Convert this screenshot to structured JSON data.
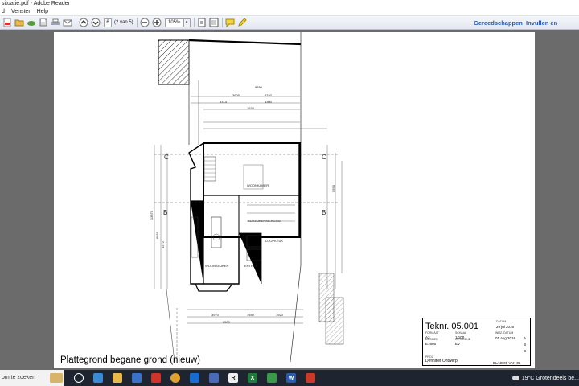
{
  "window": {
    "title": "situatie.pdf - Adobe Reader"
  },
  "menu": [
    "d",
    "Venster",
    "Help"
  ],
  "toolbar": {
    "page_current": "6",
    "page_count": "(2 van 5)",
    "zoom": "105%",
    "tools_link": "Gereedschappen",
    "fill_sign_link": "Invullen en onderteke"
  },
  "drawing": {
    "plan_title": "Plattegrond begane grond (nieuw)",
    "rooms": {
      "woonkamer": "WOONKAMER",
      "bijkeuken": "BIJKEUKEN/BERGING",
      "woonkeuken": "WOONKEUKEN",
      "entree": "ENTREE",
      "loopkeuk": "LOOPKEUK"
    },
    "axes": {
      "c": "C",
      "b": "B"
    },
    "dims": {
      "d1": "3605",
      "d2": "4340",
      "d3": "3314",
      "d4": "4300",
      "d5": "1634",
      "d6": "9880",
      "d7": "3970",
      "d8": "1940",
      "d9": "1920",
      "d10": "8500",
      "d11": "13870",
      "d12": "6850",
      "d13": "8272",
      "d14": "5590"
    },
    "titleblock": {
      "tekening_nr": "Teknr. 05.001",
      "datum": "29 jul 2016",
      "formaat": "A3",
      "schaal": "1/100",
      "dossier": "E1605",
      "getekend": "EV",
      "wijz_datum": "01 aug 2016",
      "rev_a": "A",
      "rev_b": "B",
      "rev_c": "C",
      "project_name": "Definitief Ontwerp",
      "code": "ELAO 05 VAK 05",
      "label_datum": "DATUM",
      "label_formaat": "FORMAAT",
      "label_schaal": "SCHAAL",
      "label_dossier": "DOSSIER",
      "label_getekend": "GETEKEND",
      "label_wijz": "WIJZ. DATUM",
      "label_project": "PROJ"
    }
  },
  "taskbar": {
    "search_text": "om te zoeken",
    "weather": "19°C Grotendeels be..."
  },
  "colors": {
    "accent": "#2a5aa8",
    "taskbar": "#1f2530",
    "doc_bg": "#6b6b6b"
  }
}
